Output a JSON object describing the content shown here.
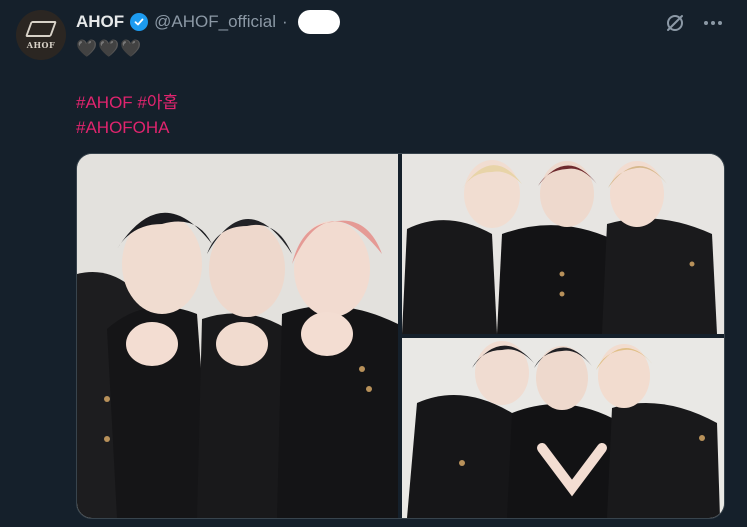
{
  "author": {
    "display_name": "AHOF",
    "handle": "@AHOF_official",
    "separator": "·",
    "avatar_text": "AHOF",
    "verified_icon": "verified-badge-icon"
  },
  "tweet": {
    "emoji_line": "🖤🖤🖤",
    "hashtags": [
      "#AHOF",
      "#아홉",
      "#AHOFOHA"
    ]
  },
  "actions": {
    "grok_icon": "grok-icon",
    "more_icon": "more-icon"
  },
  "media": {
    "photo_count": 3,
    "photos": [
      "three-members-heart-hands",
      "three-members-posing",
      "three-members-heart-gesture"
    ]
  },
  "colors": {
    "background": "#15202b",
    "hashtag": "#e0246e",
    "verified": "#1d9bf0",
    "muted": "#8b98a5"
  }
}
